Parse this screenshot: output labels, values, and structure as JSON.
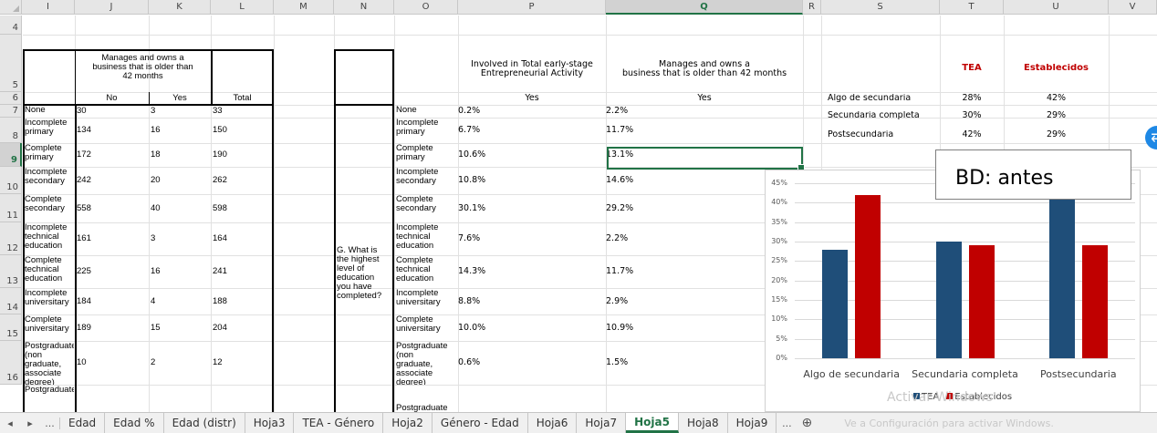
{
  "columns": [
    "I",
    "J",
    "K",
    "L",
    "M",
    "N",
    "O",
    "P",
    "Q",
    "R",
    "S",
    "T",
    "U",
    "V"
  ],
  "selected_column": "Q",
  "rows": [
    "4",
    "5",
    "6",
    "7",
    "8",
    "9",
    "10",
    "11",
    "12",
    "13",
    "14",
    "15",
    "16"
  ],
  "selected_row": "9",
  "left_table": {
    "header": "Manages and owns a\nbusiness that is older than\n42 months",
    "sub_no": "No",
    "sub_yes": "Yes",
    "sub_total": "Total",
    "labels": [
      "None",
      "Incomplete\nprimary",
      "Complete\nprimary",
      "Incomplete\nsecondary",
      "Complete\nsecondary",
      "Incomplete\ntechnical\neducation",
      "Complete\ntechnical\neducation",
      "Incomplete\nuniversitary",
      "Complete\nuniversitary",
      "Postgraduate\n(non\ngraduate,\nassociate\ndegree)",
      "Postgraduate"
    ],
    "no": [
      "30",
      "134",
      "172",
      "242",
      "558",
      "161",
      "225",
      "184",
      "189",
      "10"
    ],
    "yes": [
      "3",
      "16",
      "18",
      "20",
      "40",
      "3",
      "16",
      "4",
      "15",
      "2"
    ],
    "total": [
      "33",
      "150",
      "190",
      "262",
      "598",
      "164",
      "241",
      "188",
      "204",
      "12"
    ]
  },
  "right_table": {
    "question": "G.  What is\nthe highest\nlevel of\neducation\nyou have\ncompleted?",
    "labels": [
      "None",
      "Incomplete\nprimary",
      "Complete\nprimary",
      "Incomplete\nsecondary",
      "Complete\nsecondary",
      "Incomplete\ntechnical\neducation",
      "Complete\ntechnical\neducation",
      "Incomplete\nuniversitary",
      "Complete\nuniversitary",
      "Postgraduate\n(non\ngraduate,\nassociate\ndegree)",
      "Postgraduate"
    ],
    "p_header": "Involved in Total early-stage\nEntrepreneurial Activity",
    "q_header": "Manages and owns a\nbusiness that is older than 42 months",
    "p_sub": "Yes",
    "q_sub": "Yes",
    "p_values": [
      "0.2%",
      "6.7%",
      "10.6%",
      "10.8%",
      "30.1%",
      "7.6%",
      "14.3%",
      "8.8%",
      "10.0%",
      "0.6%"
    ],
    "q_values": [
      "2.2%",
      "11.7%",
      "13.1%",
      "14.6%",
      "29.2%",
      "2.2%",
      "11.7%",
      "2.9%",
      "10.9%",
      "1.5%"
    ]
  },
  "summary": {
    "header_tea": "TEA",
    "header_est": "Establecidos",
    "rows": [
      {
        "label": "Algo de secundaria",
        "tea": "28%",
        "est": "42%"
      },
      {
        "label": "Secundaria completa",
        "tea": "30%",
        "est": "29%"
      },
      {
        "label": "Postsecundaria",
        "tea": "42%",
        "est": "29%"
      }
    ]
  },
  "textbox": "BD: antes",
  "chart_data": {
    "type": "bar",
    "categories": [
      "Algo de secundaria",
      "Secundaria completa",
      "Postsecundaria"
    ],
    "series": [
      {
        "name": "TEA",
        "values": [
          28,
          30,
          42
        ],
        "color": "#1f4e79"
      },
      {
        "name": "Establecidos",
        "values": [
          42,
          29,
          29
        ],
        "color": "#c00000"
      }
    ],
    "ylim": [
      0,
      45
    ],
    "yticks": [
      "0%",
      "5%",
      "10%",
      "15%",
      "20%",
      "25%",
      "30%",
      "35%",
      "40%",
      "45%"
    ],
    "grid": true,
    "legend": "bottom"
  },
  "watermark": {
    "title": "Activar Windows",
    "subtitle": "Ve a Configuración para activar Windows."
  },
  "tabs": [
    "Edad",
    "Edad %",
    "Edad (distr)",
    "Hoja3",
    "TEA - Género",
    "Hoja2",
    "Género - Edad",
    "Hoja6",
    "Hoja7",
    "Hoja5",
    "Hoja8",
    "Hoja9"
  ],
  "active_tab": "Hoja5",
  "nav": {
    "prev": "◂",
    "next": "▸",
    "more": "...",
    "tab_more": "...",
    "add": "⊕"
  }
}
